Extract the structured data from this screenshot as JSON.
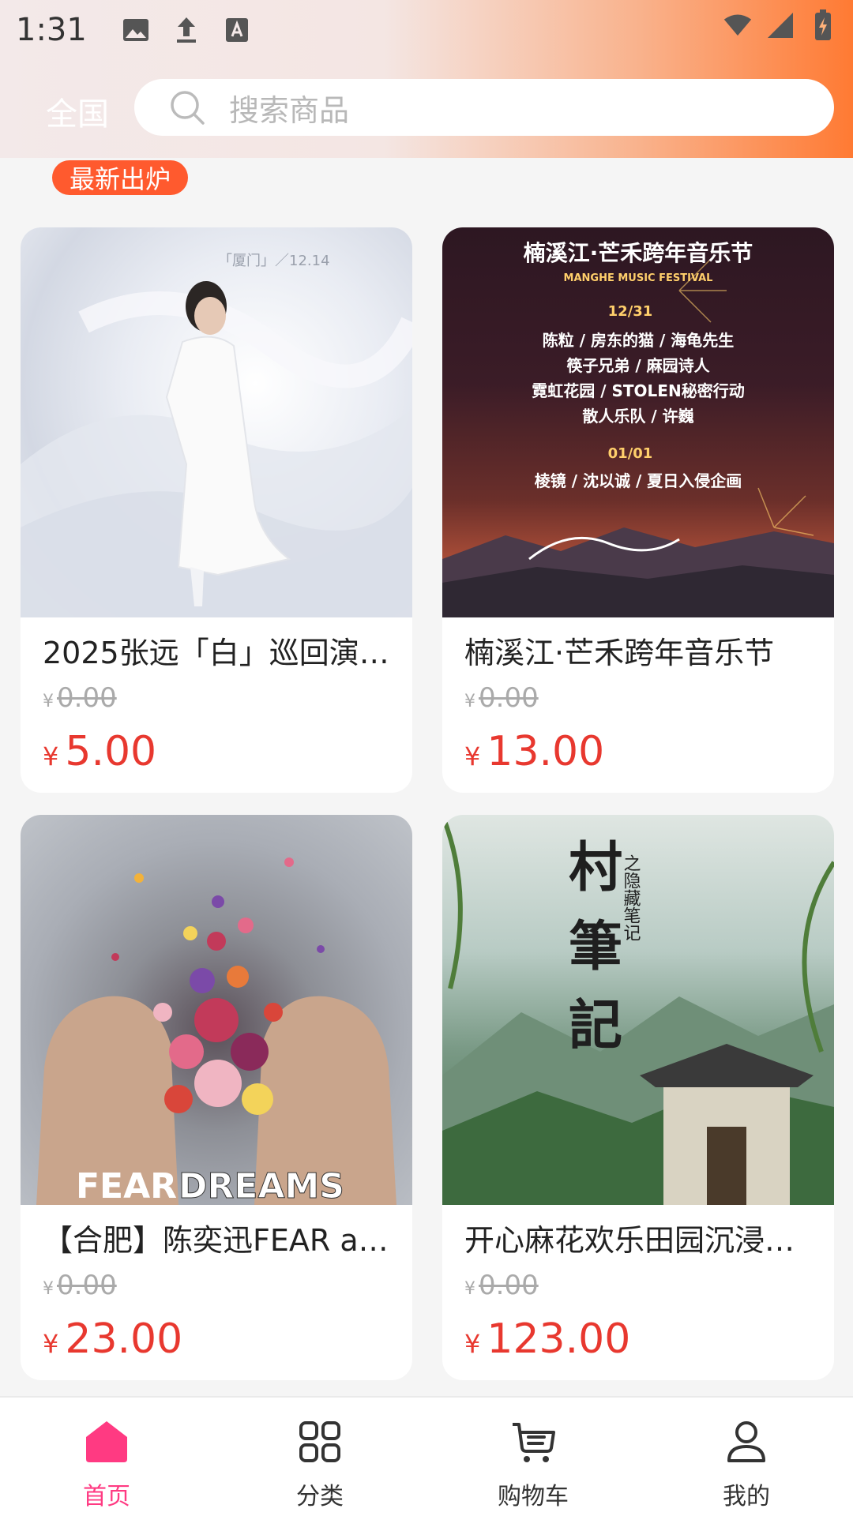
{
  "status_bar": {
    "time": "1:31"
  },
  "header": {
    "region": "全国",
    "search_placeholder": "搜索商品"
  },
  "section": {
    "badge": "最新出炉"
  },
  "colors": {
    "accent": "#ff5a2e",
    "price": "#e8382f",
    "nav_active": "#ff3a82"
  },
  "products": [
    {
      "title": "2025张远「白」巡回演…",
      "currency": "¥",
      "original_price": "0.00",
      "price": "5.00",
      "poster_text": [
        "「厦门」／12.14"
      ]
    },
    {
      "title": "楠溪江·芒禾跨年音乐节",
      "currency": "¥",
      "original_price": "0.00",
      "price": "13.00",
      "poster_text": [
        "楠溪江·芒禾跨年音乐节",
        "MANGHE MUSIC FESTIVAL",
        "12/31",
        "陈粒 / 房东的猫 / 海龟先生",
        "筷子兄弟 / 麻园诗人",
        "霓虹花园 / STOLEN秘密行动",
        "散人乐队 / 许巍",
        "01/01",
        "棱镜 / 沈以诚 / 夏日入侵企画"
      ]
    },
    {
      "title": "【合肥】陈奕迅FEAR a…",
      "currency": "¥",
      "original_price": "0.00",
      "price": "23.00",
      "poster_text": [
        "FEAR",
        "DREAMS"
      ]
    },
    {
      "title": "开心麻花欢乐田园沉浸…",
      "currency": "¥",
      "original_price": "0.00",
      "price": "123.00",
      "poster_text": [
        "村",
        "筆",
        "記",
        "之隐藏笔记"
      ]
    }
  ],
  "nav": {
    "items": [
      {
        "label": "首页",
        "icon": "home-icon",
        "active": true
      },
      {
        "label": "分类",
        "icon": "category-icon",
        "active": false
      },
      {
        "label": "购物车",
        "icon": "cart-icon",
        "active": false
      },
      {
        "label": "我的",
        "icon": "user-icon",
        "active": false
      }
    ]
  }
}
